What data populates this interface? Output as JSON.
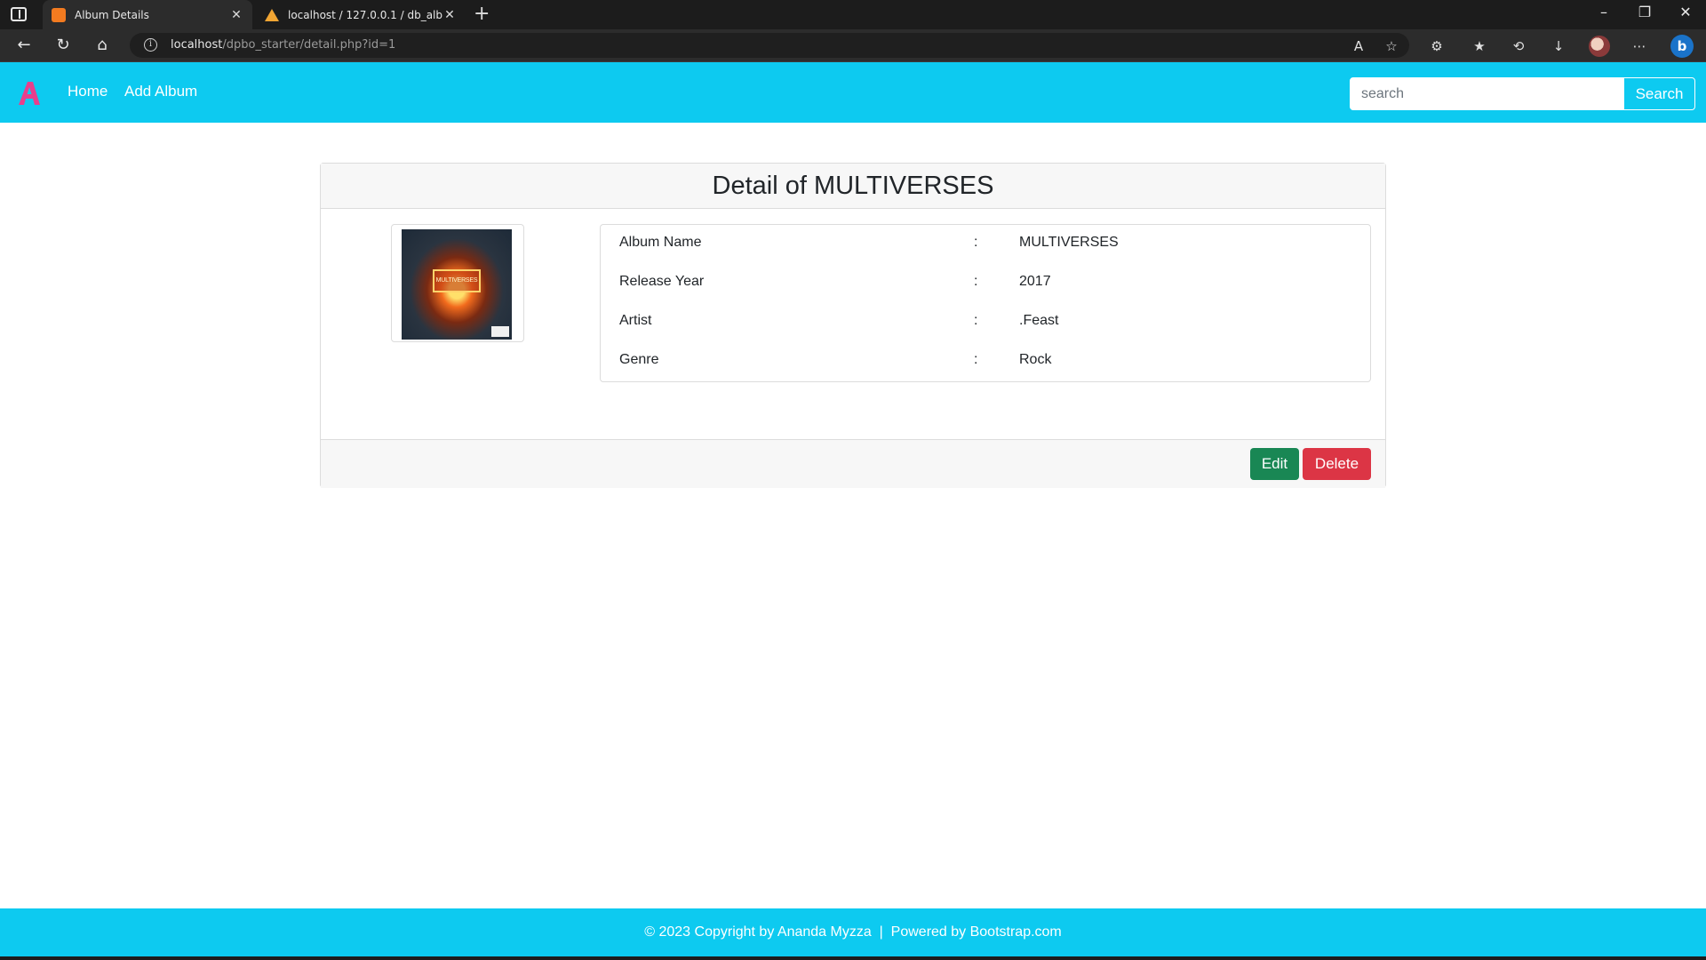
{
  "browser": {
    "tabs": [
      {
        "title": "Album Details",
        "favicon": "xampp-icon",
        "active": true
      },
      {
        "title": "localhost / 127.0.0.1 / db_album",
        "favicon": "phpmyadmin-icon",
        "active": false
      }
    ],
    "url_host": "localhost",
    "url_path": "/dpbo_starter/detail.php?id=1"
  },
  "navbar": {
    "brand": "A",
    "links": [
      "Home",
      "Add Album"
    ],
    "search_placeholder": "search",
    "search_button": "Search"
  },
  "card": {
    "title": "Detail of MULTIVERSES",
    "cover_text": "MULTIVERSES",
    "fields": [
      {
        "label": "Album Name",
        "value": "MULTIVERSES"
      },
      {
        "label": "Release Year",
        "value": "2017"
      },
      {
        "label": "Artist",
        "value": ".Feast"
      },
      {
        "label": "Genre",
        "value": "Rock"
      }
    ],
    "separator": ":",
    "edit_label": "Edit",
    "delete_label": "Delete"
  },
  "footer": {
    "text": "© 2023 Copyright by Ananda Myzza  |  Powered by Bootstrap.com"
  },
  "colors": {
    "primary": "#0dcaf0",
    "edit": "#198754",
    "delete": "#dc3545",
    "brand": "#e83e8c"
  }
}
